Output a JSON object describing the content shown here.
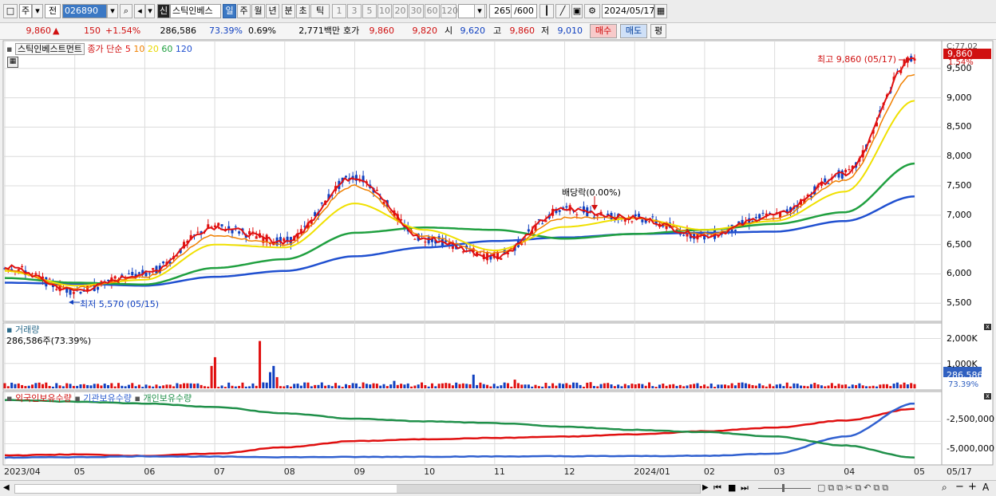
{
  "toolbar": {
    "market": "주",
    "jeon": "전",
    "code": "026890",
    "sin": "신",
    "stock_name": "스틱인베스",
    "periods": [
      "일",
      "주",
      "월",
      "년",
      "분",
      "초",
      "틱"
    ],
    "selected_period": "일",
    "intervals": [
      "1",
      "3",
      "5",
      "10",
      "20",
      "30",
      "60",
      "120"
    ],
    "count": "265",
    "count_max": "/600",
    "date": "2024/05/17"
  },
  "quote": {
    "price": "9,860",
    "arrow": "▲",
    "change": "150",
    "change_pct": "+1.54%",
    "volume": "286,586",
    "volume_pct": "73.39%",
    "turnover_pct": "0.69%",
    "amount": "2,771백만",
    "hoga_label": "호가",
    "ask": "9,860",
    "bid": "9,820",
    "open_label": "시",
    "open": "9,620",
    "high_label": "고",
    "high": "9,860",
    "low_label": "저",
    "low": "9,010",
    "buy_button": "매수",
    "sell_button": "매도",
    "eval_button": "평"
  },
  "price_pane": {
    "title": "스틱인베스트먼트",
    "ma_title": "종가 단순",
    "ma_periods": [
      "5",
      "10",
      "20",
      "60",
      "120"
    ],
    "y_ticks": [
      "9,500",
      "9,000",
      "8,500",
      "8,000",
      "7,500",
      "7,000",
      "6,500",
      "6,000",
      "5,500"
    ],
    "y_top_label": "C:77.02",
    "last_price_tag": "9,860",
    "last_pct_tag": "1.54%",
    "high_annotation": "최고 9,860 (05/17)",
    "low_annotation": "최저 5,570 (05/15)",
    "dividend_annotation": "배당락(0.00%)"
  },
  "volume_pane": {
    "title": "거래량",
    "value_text": "286,586주(73.39%)",
    "y_ticks": [
      "2,000K",
      "1,000K"
    ],
    "last_tag": "286,586",
    "last_pct": "73.39%"
  },
  "holdings_pane": {
    "series_labels": [
      "외국인보유수량",
      "기관보유수량",
      "개인보유수량"
    ],
    "y_ticks": [
      "-2,500,000",
      "-5,000,000"
    ]
  },
  "x_axis": {
    "labels": [
      "2023/04",
      "05",
      "06",
      "07",
      "08",
      "09",
      "10",
      "11",
      "12",
      "2024/01",
      "02",
      "03",
      "04",
      "05"
    ],
    "right_label": "05/17"
  },
  "colors": {
    "ma5": "#e01010",
    "ma10": "#f08000",
    "ma20": "#f0e000",
    "ma60": "#20a040",
    "ma120": "#2050d0",
    "up": "#e01010",
    "down": "#1040c0",
    "foreign": "#e01010",
    "institution": "#3060d0",
    "individual": "#20904a"
  },
  "chart_data": [
    {
      "type": "line",
      "name": "price",
      "x": [
        "2023/04",
        "05",
        "06",
        "07",
        "08",
        "09",
        "10",
        "11",
        "12",
        "2024/01",
        "02",
        "03",
        "04",
        "05"
      ],
      "series": [
        {
          "name": "5",
          "values": [
            6120,
            5720,
            6000,
            6800,
            6550,
            7650,
            6600,
            6300,
            7100,
            6950,
            6650,
            7000,
            7700,
            9700
          ]
        },
        {
          "name": "10",
          "values": [
            6080,
            5760,
            5950,
            6650,
            6500,
            7500,
            6650,
            6350,
            6950,
            6950,
            6680,
            6950,
            7600,
            9400
          ]
        },
        {
          "name": "20",
          "values": [
            6050,
            5800,
            5900,
            6500,
            6450,
            7200,
            6750,
            6400,
            6800,
            6950,
            6750,
            6900,
            7400,
            8950
          ]
        },
        {
          "name": "60",
          "values": [
            5930,
            5850,
            5820,
            6100,
            6250,
            6700,
            6790,
            6750,
            6600,
            6680,
            6750,
            6850,
            7050,
            7880
          ]
        },
        {
          "name": "120",
          "values": [
            5850,
            5830,
            5800,
            5950,
            6050,
            6300,
            6450,
            6560,
            6620,
            6680,
            6700,
            6720,
            6900,
            7320
          ]
        }
      ],
      "ylim": [
        5300,
        9850
      ]
    },
    {
      "type": "bar",
      "name": "volume",
      "ylim": [
        0,
        2400
      ]
    },
    {
      "type": "line",
      "name": "holdings",
      "x": [
        "2023/04",
        "05",
        "06",
        "07",
        "08",
        "09",
        "10",
        "11",
        "12",
        "2024/01",
        "02",
        "03",
        "04",
        "05"
      ],
      "series": [
        {
          "name": "외국인보유수량",
          "values": [
            -6300000,
            -6200000,
            -6350000,
            -6100000,
            -5400000,
            -4700000,
            -4500000,
            -4350000,
            -4200000,
            -3950000,
            -3600000,
            -3200000,
            -2400000,
            -1100000
          ]
        },
        {
          "name": "기관보유수량",
          "values": [
            -6550000,
            -6500000,
            -6400000,
            -6450000,
            -6500000,
            -6480000,
            -6450000,
            -6420000,
            -6400000,
            -6380000,
            -6350000,
            -6100000,
            -4200000,
            -500000
          ]
        },
        {
          "name": "개인보유수량",
          "values": [
            -100000,
            -300000,
            -500000,
            -900000,
            -1600000,
            -2200000,
            -2500000,
            -2700000,
            -3100000,
            -3450000,
            -3700000,
            -4200000,
            -5200000,
            -6550000
          ]
        }
      ],
      "ylim": [
        -7100000,
        300000
      ]
    }
  ]
}
